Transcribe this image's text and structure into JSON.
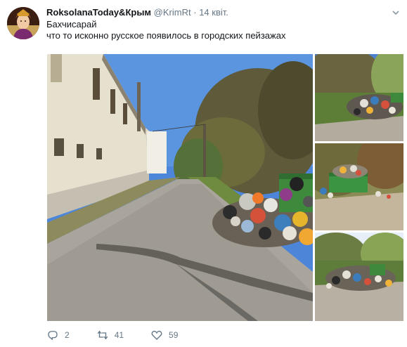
{
  "author": {
    "name": "RoksolanaToday&Крым",
    "handle": "@KrimRt",
    "separator": "·",
    "time": "14 квіт."
  },
  "tweet": {
    "line1": "Бахчисарай",
    "line2": "что то исконно русское появилось в городских пейзажах"
  },
  "media": {
    "photos": [
      {
        "name": "main-photo",
        "subject": "street-with-garbage-pile"
      },
      {
        "name": "photo-top-right",
        "subject": "garbage-heap-on-grass"
      },
      {
        "name": "photo-middle-right",
        "subject": "green-bins-with-garbage"
      },
      {
        "name": "photo-bottom-right",
        "subject": "garbage-by-roadside"
      }
    ]
  },
  "actions": {
    "reply_count": "2",
    "retweet_count": "41",
    "like_count": "59"
  },
  "icons": {
    "reply": "reply-icon",
    "retweet": "retweet-icon",
    "like": "heart-icon",
    "menu": "chevron-down-icon"
  },
  "colors": {
    "text": "#14171a",
    "secondary": "#657786",
    "sky": "#4d86d8"
  }
}
